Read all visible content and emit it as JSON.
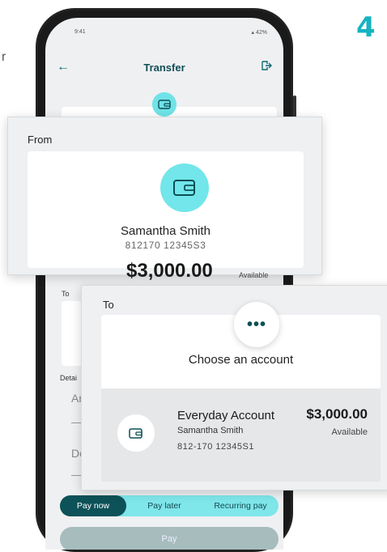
{
  "step_number": "4",
  "edge_text": "r",
  "status_bar": {
    "time": "9:41",
    "battery": "▴ 42%"
  },
  "nav": {
    "title": "Transfer"
  },
  "from": {
    "label": "From",
    "name": "Samantha Smith",
    "account_number": "812170  12345S3",
    "amount": "$3,000.00",
    "available_label": "Available"
  },
  "background_form": {
    "to_label": "To",
    "details_label": "Detai",
    "amount_field_partial": "Ar",
    "description_field_partial": "De"
  },
  "to": {
    "label": "To",
    "more_button": "•••",
    "prompt": "Choose an account",
    "account": {
      "name": "Everyday Account",
      "owner": "Samantha Smith",
      "number": "812-170  12345S1",
      "amount": "$3,000.00",
      "available_label": "Available"
    }
  },
  "schedule_tabs": [
    "Pay now",
    "Pay later",
    "Recurring pay"
  ],
  "active_tab": "Pay now",
  "pay_button": "Pay",
  "colors": {
    "accent": "#17b3c1",
    "wallet_bg": "#72e6ea",
    "dark_teal": "#0d5258",
    "segment_bg": "#7fe6ea"
  },
  "icons": [
    "back-arrow-icon",
    "exit-icon",
    "wallet-icon",
    "dropdown-caret-icon",
    "more-dots-icon",
    "wifi-icon",
    "battery-icon"
  ]
}
